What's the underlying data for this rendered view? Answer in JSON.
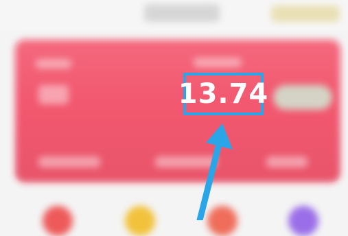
{
  "card": {
    "highlighted_value": "13.74"
  },
  "colors": {
    "card": "#f2586f",
    "highlight": "#2aa6e8",
    "arrow": "#2aa6e8"
  },
  "icons": [
    "up-arrow-icon"
  ]
}
